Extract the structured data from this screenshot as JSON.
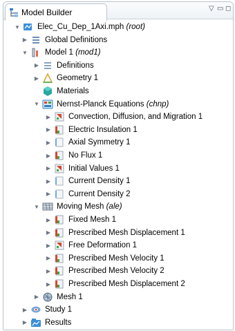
{
  "window": {
    "tab_label": "Model Builder",
    "controls": {
      "menu": "▽",
      "minimize": "▭",
      "maximize": "◻"
    }
  },
  "tree": [
    {
      "level": 0,
      "toggle": "open",
      "icon": "mph-file-icon",
      "label": "Elec_Cu_Dep_1Axi.mph",
      "tag": "(root)"
    },
    {
      "level": 1,
      "toggle": "closed",
      "icon": "global-definitions-icon",
      "label": "Global Definitions",
      "tag": ""
    },
    {
      "level": 1,
      "toggle": "open",
      "icon": "model-icon",
      "label": "Model 1",
      "tag": "(mod1)"
    },
    {
      "level": 2,
      "toggle": "closed",
      "icon": "definitions-icon",
      "label": "Definitions",
      "tag": ""
    },
    {
      "level": 2,
      "toggle": "closed",
      "icon": "geometry-icon",
      "label": "Geometry 1",
      "tag": ""
    },
    {
      "level": 2,
      "toggle": "none",
      "icon": "materials-icon",
      "label": "Materials",
      "tag": ""
    },
    {
      "level": 2,
      "toggle": "open",
      "icon": "physics-icon",
      "label": "Nernst-Planck Equations",
      "tag": "(chnp)"
    },
    {
      "level": 3,
      "toggle": "closed",
      "icon": "domain-feature-icon",
      "label": "Convection, Diffusion, and Migration 1",
      "tag": ""
    },
    {
      "level": 3,
      "toggle": "closed",
      "icon": "boundary-feature-icon",
      "label": "Electric Insulation 1",
      "tag": ""
    },
    {
      "level": 3,
      "toggle": "closed",
      "icon": "boundary-plain-icon",
      "label": "Axial Symmetry 1",
      "tag": ""
    },
    {
      "level": 3,
      "toggle": "closed",
      "icon": "boundary-feature-icon",
      "label": "No Flux 1",
      "tag": ""
    },
    {
      "level": 3,
      "toggle": "closed",
      "icon": "domain-feature-icon",
      "label": "Initial Values 1",
      "tag": ""
    },
    {
      "level": 3,
      "toggle": "closed",
      "icon": "boundary-plain-icon",
      "label": "Current Density 1",
      "tag": ""
    },
    {
      "level": 3,
      "toggle": "closed",
      "icon": "boundary-plain-icon",
      "label": "Current Density 2",
      "tag": ""
    },
    {
      "level": 2,
      "toggle": "open",
      "icon": "moving-mesh-icon",
      "label": "Moving Mesh",
      "tag": "(ale)"
    },
    {
      "level": 3,
      "toggle": "closed",
      "icon": "boundary-feature-icon",
      "label": "Fixed Mesh 1",
      "tag": ""
    },
    {
      "level": 3,
      "toggle": "closed",
      "icon": "boundary-feature-icon",
      "label": "Prescribed Mesh Displacement 1",
      "tag": ""
    },
    {
      "level": 3,
      "toggle": "closed",
      "icon": "domain-feature-icon",
      "label": "Free Deformation 1",
      "tag": ""
    },
    {
      "level": 3,
      "toggle": "closed",
      "icon": "boundary-feature-icon",
      "label": "Prescribed Mesh Velocity 1",
      "tag": ""
    },
    {
      "level": 3,
      "toggle": "closed",
      "icon": "boundary-feature-icon",
      "label": "Prescribed Mesh Velocity 2",
      "tag": ""
    },
    {
      "level": 3,
      "toggle": "closed",
      "icon": "boundary-feature-icon",
      "label": "Prescribed Mesh Displacement 2",
      "tag": ""
    },
    {
      "level": 2,
      "toggle": "closed",
      "icon": "mesh-icon",
      "label": "Mesh 1",
      "tag": ""
    },
    {
      "level": 1,
      "toggle": "closed",
      "icon": "study-icon",
      "label": "Study 1",
      "tag": ""
    },
    {
      "level": 1,
      "toggle": "closed",
      "icon": "results-icon",
      "label": "Results",
      "tag": ""
    }
  ],
  "colors": {
    "accent_blue": "#2f7fc8",
    "feature_red": "#d8452e",
    "feature_green": "#3aa845",
    "border": "#b9c3cd"
  }
}
